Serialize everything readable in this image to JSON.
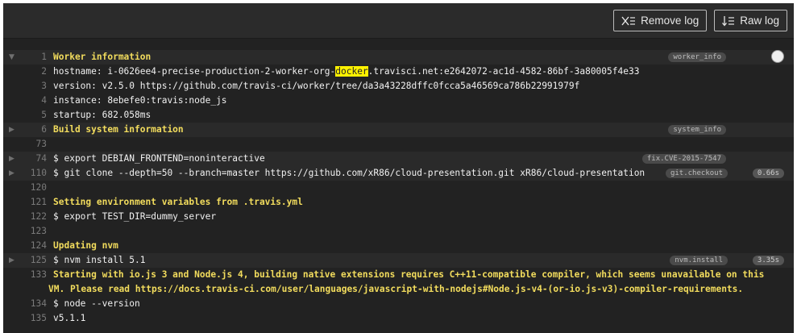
{
  "toolbar": {
    "remove_log_label": "Remove log",
    "raw_log_label": "Raw log"
  },
  "lines": [
    {
      "num": "1",
      "text": "Worker information",
      "style": "yellow",
      "fold": "open",
      "tag": "worker_info",
      "dot": true
    },
    {
      "num": "2",
      "pre": "hostname: i-0626ee4-precise-production-2-worker-org-",
      "hl": "docker",
      "post": ".travisci.net:e2642072-ac1d-4582-86bf-3a80005f4e33"
    },
    {
      "num": "3",
      "text": "version: v2.5.0 https://github.com/travis-ci/worker/tree/da3a43228dffc0fcca5a46569ca786b22991979f"
    },
    {
      "num": "4",
      "text": "instance: 8ebefe0:travis:node_js"
    },
    {
      "num": "5",
      "text": "startup: 682.058ms"
    },
    {
      "num": "6",
      "text": "Build system information",
      "style": "yellow",
      "fold": "closed",
      "tag": "system_info"
    },
    {
      "num": "73",
      "text": ""
    },
    {
      "num": "74",
      "text": "$ export DEBIAN_FRONTEND=noninteractive",
      "fold": "closed",
      "tag": "fix.CVE-2015-7547"
    },
    {
      "num": "110",
      "text": "$ git clone --depth=50 --branch=master https://github.com/xR86/cloud-presentation.git xR86/cloud-presentation",
      "fold": "closed",
      "tag": "git.checkout",
      "dur": "0.66s"
    },
    {
      "num": "120",
      "text": ""
    },
    {
      "num": "121",
      "text": "Setting environment variables from .travis.yml",
      "style": "yellow"
    },
    {
      "num": "122",
      "text": "$ export TEST_DIR=dummy_server"
    },
    {
      "num": "123",
      "text": ""
    },
    {
      "num": "124",
      "text": "Updating nvm",
      "style": "yellow"
    },
    {
      "num": "125",
      "text": "$ nvm install 5.1",
      "fold": "closed",
      "tag": "nvm.install",
      "dur": "3.35s"
    },
    {
      "num": "133",
      "text": "Starting with io.js 3 and Node.js 4, building native extensions requires C++11-compatible compiler, which seems unavailable on this VM. Please read https://docs.travis-ci.com/user/languages/javascript-with-nodejs#Node.js-v4-(or-io.js-v3)-compiler-requirements.",
      "style": "yellow",
      "wrap": true
    },
    {
      "num": "134",
      "text": "$ node --version"
    },
    {
      "num": "135",
      "text": "v5.1.1"
    }
  ]
}
